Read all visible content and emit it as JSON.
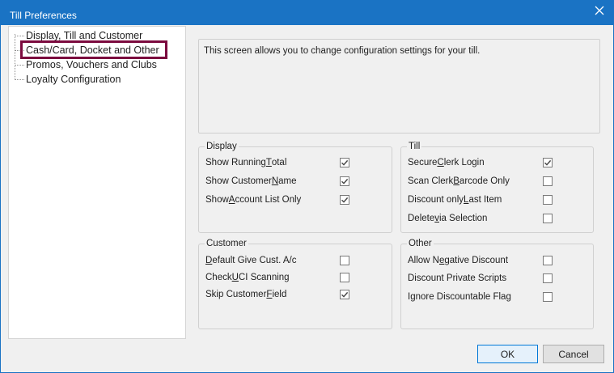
{
  "window": {
    "title": "Till Preferences"
  },
  "tree": {
    "items": [
      {
        "label": "Display, Till and Customer"
      },
      {
        "label": "Cash/Card, Docket and Other"
      },
      {
        "label": "Promos, Vouchers and Clubs"
      },
      {
        "label": "Loyalty Configuration"
      }
    ]
  },
  "description": "This screen allows you to change configuration settings for your till.",
  "groups": {
    "display": {
      "title": "Display",
      "options": [
        {
          "label": "Show Running Total",
          "checked": true
        },
        {
          "label": "Show Customer Name",
          "checked": true
        },
        {
          "label": "Show Account List Only",
          "checked": true
        }
      ]
    },
    "till": {
      "title": "Till",
      "options": [
        {
          "label": "Secure Clerk Login",
          "checked": true
        },
        {
          "label": "Scan Clerk Barcode Only",
          "checked": false
        },
        {
          "label": "Discount only Last Item",
          "checked": false
        },
        {
          "label": "Delete via Selection",
          "checked": false
        }
      ]
    },
    "customer": {
      "title": "Customer",
      "options": [
        {
          "label": "Default Give Cust. A/c",
          "checked": false
        },
        {
          "label": "Check UCI Scanning",
          "checked": false
        },
        {
          "label": "Skip Customer Field",
          "checked": true
        }
      ]
    },
    "other": {
      "title": "Other",
      "options": [
        {
          "label": "Allow Negative Discount",
          "checked": false
        },
        {
          "label": "Discount Private Scripts",
          "checked": false
        },
        {
          "label": "Ignore Discountable Flag",
          "checked": false
        }
      ]
    }
  },
  "buttons": {
    "ok": "OK",
    "cancel": "Cancel"
  },
  "colors": {
    "titlebar": "#1a73c4",
    "selection_outline": "#7b0a3e"
  },
  "icons": {
    "close": "close-icon",
    "check": "check-icon"
  }
}
